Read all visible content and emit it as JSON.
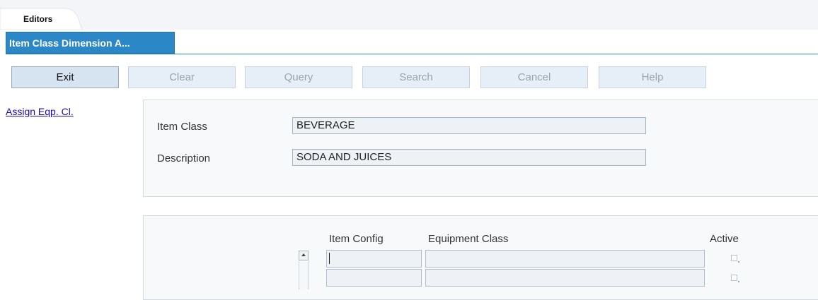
{
  "tabs": {
    "editors": "Editors",
    "document": "Item Class Dimension A..."
  },
  "toolbar": {
    "exit": "Exit",
    "clear": "Clear",
    "query": "Query",
    "search": "Search",
    "cancel": "Cancel",
    "help": "Help"
  },
  "side_nav": {
    "assign_link": "Assign Eqp. Cl."
  },
  "form": {
    "item_class_label": "Item Class",
    "item_class_value": "BEVERAGE",
    "description_label": "Description",
    "description_value": "SODA AND JUICES"
  },
  "grid": {
    "columns": [
      "Item Config",
      "Equipment Class",
      "Active"
    ],
    "rows": [
      {
        "item_config": "",
        "equipment_class": "",
        "active": false
      },
      {
        "item_config": "",
        "equipment_class": "",
        "active": false
      }
    ]
  },
  "colors": {
    "accent": "#2c87c7",
    "link": "#1a0dab"
  }
}
